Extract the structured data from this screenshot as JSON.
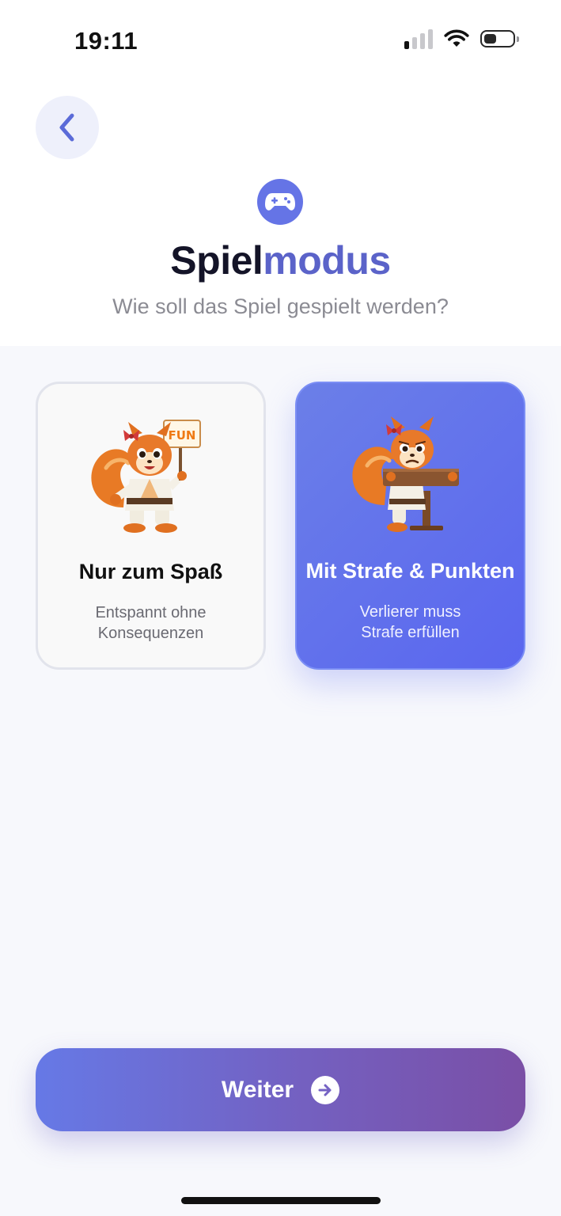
{
  "status_bar": {
    "time": "19:11",
    "icons": [
      "cellular-signal-icon",
      "wifi-icon",
      "battery-icon"
    ],
    "signal_bars_active": 1,
    "battery_level": 0.4
  },
  "header": {
    "back_icon": "chevron-left-icon",
    "mode_icon": "gamepad-icon",
    "title_part1": "Spiel",
    "title_part2": "modus",
    "subtitle": "Wie soll das Spiel gespielt werden?"
  },
  "options": [
    {
      "title": "Nur zum Spaß",
      "description_line1": "Entspannt ohne",
      "description_line2": "Konsequenzen",
      "sign_text": "FUN",
      "selected": false
    },
    {
      "title": "Mit Strafe & Punkten",
      "description_line1": "Verlierer muss",
      "description_line2": "Strafe erfüllen",
      "selected": true
    }
  ],
  "footer": {
    "continue_label": "Weiter",
    "continue_icon": "arrow-right-icon"
  },
  "colors": {
    "accent": "#5a66ef",
    "title_accent": "#5b63c9",
    "button_gradient_start": "#6679e6",
    "button_gradient_end": "#7a4fa6"
  }
}
